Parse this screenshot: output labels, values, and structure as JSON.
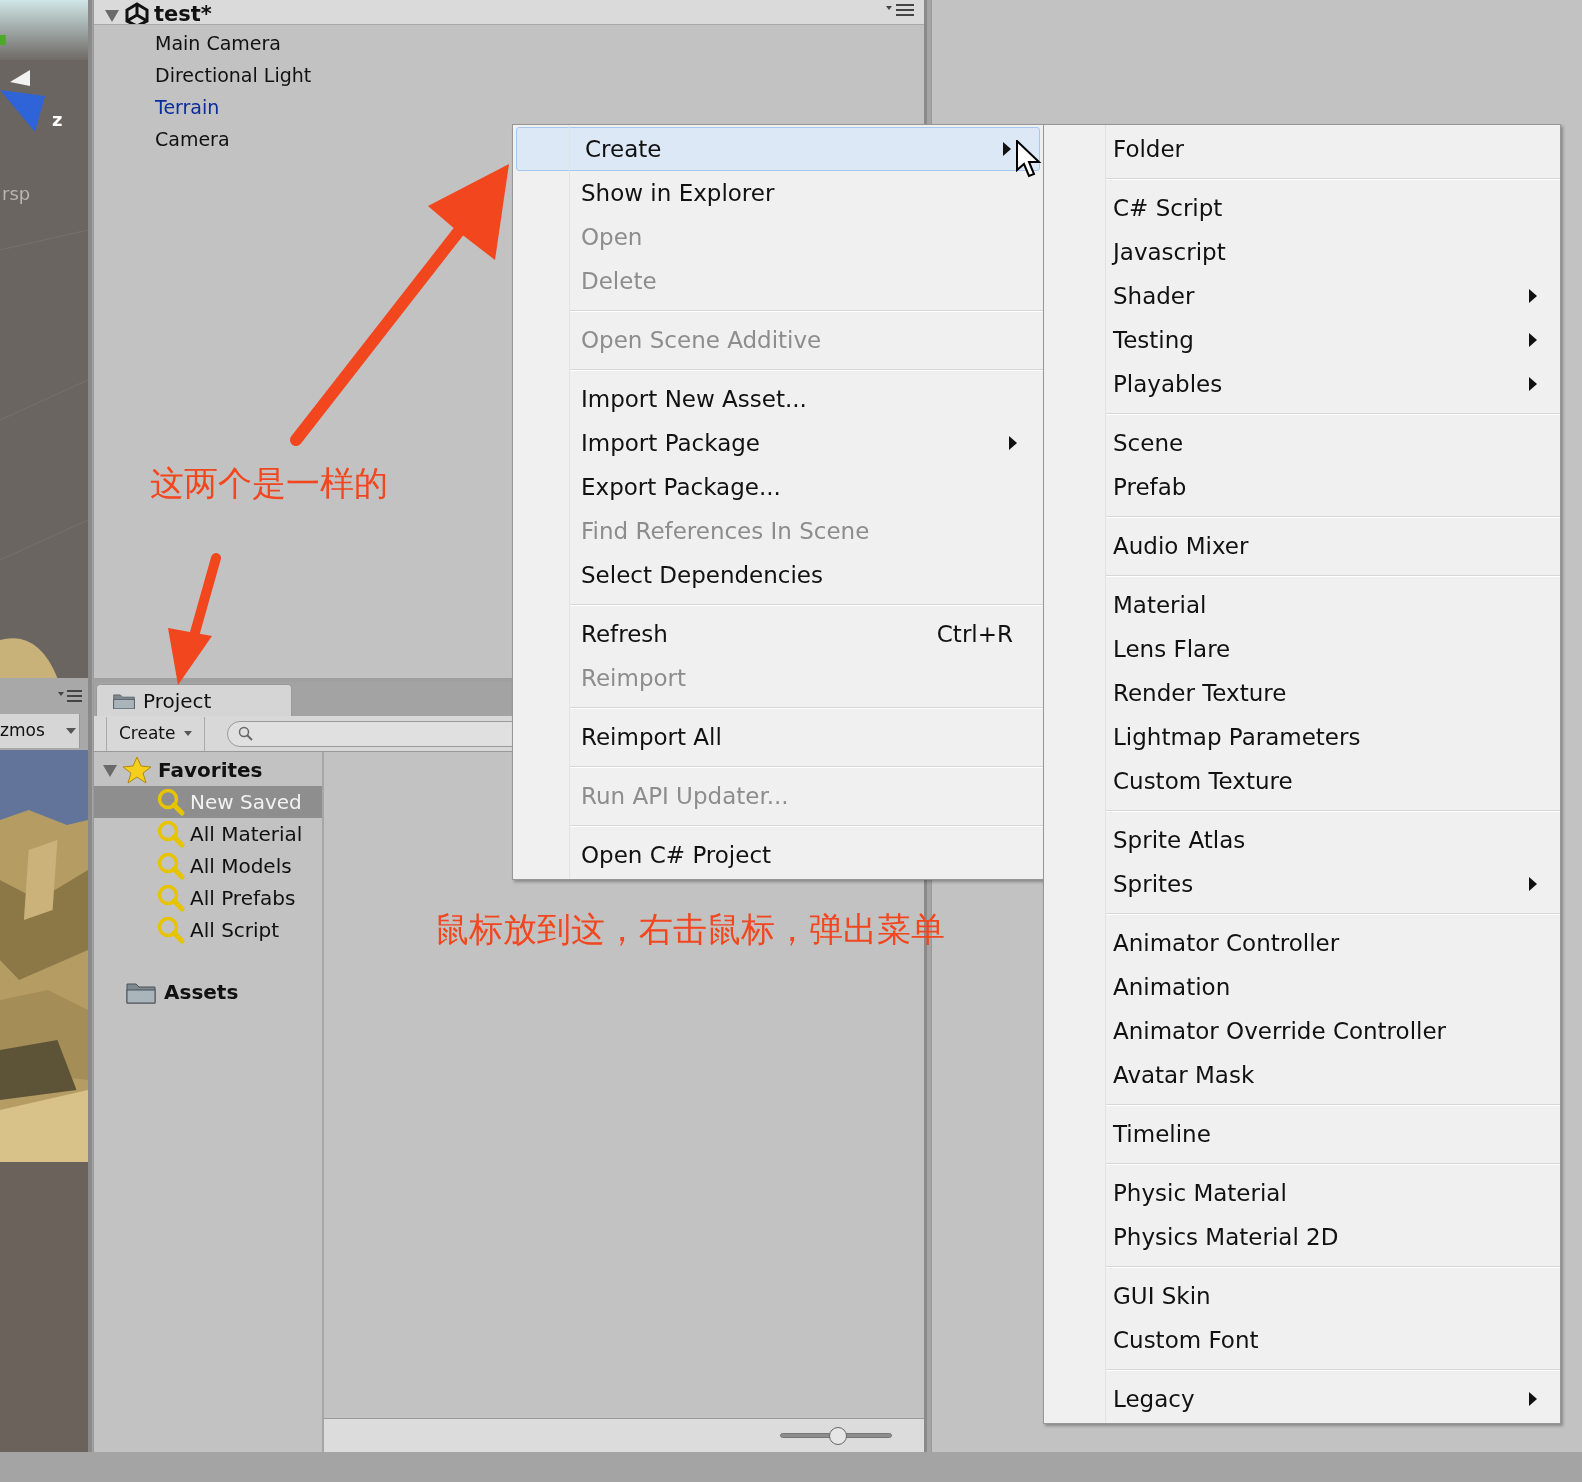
{
  "scene_view": {
    "label": "rsp",
    "axis": "z"
  },
  "scene_toolbar": {
    "gizmos": "zmos"
  },
  "hierarchy": {
    "scene": "test*",
    "expanded": true,
    "items": [
      {
        "label": "Main Camera",
        "prefab": false
      },
      {
        "label": "Directional Light",
        "prefab": false
      },
      {
        "label": "Terrain",
        "prefab": true
      },
      {
        "label": "Camera",
        "prefab": false
      }
    ]
  },
  "project": {
    "tab": "Project",
    "create_button": "Create",
    "tree": [
      {
        "label": "Favorites",
        "kind": "favorites",
        "expanded": true,
        "children": [
          {
            "label": "New Saved",
            "selected": true
          },
          {
            "label": "All Material",
            "selected": false
          },
          {
            "label": "All Models",
            "selected": false
          },
          {
            "label": "All Prefabs",
            "selected": false
          },
          {
            "label": "All Script",
            "selected": false
          }
        ]
      },
      {
        "label": "Assets",
        "kind": "folder"
      }
    ],
    "zoom_slider": {
      "level": 0.52
    }
  },
  "context_menu": {
    "groups": [
      {
        "items": [
          {
            "label": "Create",
            "disabled": false,
            "submenu": true,
            "selected": true
          },
          {
            "label": "Show in Explorer",
            "disabled": false,
            "submenu": false,
            "selected": false
          },
          {
            "label": "Open",
            "disabled": true,
            "submenu": false,
            "selected": false
          },
          {
            "label": "Delete",
            "disabled": true,
            "submenu": false,
            "selected": false
          }
        ]
      },
      {
        "items": [
          {
            "label": "Open Scene Additive",
            "disabled": true,
            "submenu": false,
            "selected": false
          }
        ]
      },
      {
        "items": [
          {
            "label": "Import New Asset...",
            "disabled": false,
            "submenu": false,
            "selected": false
          },
          {
            "label": "Import Package",
            "disabled": false,
            "submenu": true,
            "selected": false
          },
          {
            "label": "Export Package...",
            "disabled": false,
            "submenu": false,
            "selected": false
          },
          {
            "label": "Find References In Scene",
            "disabled": true,
            "submenu": false,
            "selected": false
          },
          {
            "label": "Select Dependencies",
            "disabled": false,
            "submenu": false,
            "selected": false
          }
        ]
      },
      {
        "items": [
          {
            "label": "Refresh",
            "shortcut": "Ctrl+R",
            "disabled": false,
            "submenu": false,
            "selected": false
          },
          {
            "label": "Reimport",
            "disabled": true,
            "submenu": false,
            "selected": false
          }
        ]
      },
      {
        "items": [
          {
            "label": "Reimport All",
            "disabled": false,
            "submenu": false,
            "selected": false
          }
        ]
      },
      {
        "items": [
          {
            "label": "Run API Updater...",
            "disabled": true,
            "submenu": false,
            "selected": false
          }
        ]
      },
      {
        "items": [
          {
            "label": "Open C# Project",
            "disabled": false,
            "submenu": false,
            "selected": false
          }
        ]
      }
    ]
  },
  "submenu": {
    "groups": [
      {
        "items": [
          {
            "label": "Folder",
            "submenu": false
          }
        ]
      },
      {
        "items": [
          {
            "label": "C# Script",
            "submenu": false
          },
          {
            "label": "Javascript",
            "submenu": false
          },
          {
            "label": "Shader",
            "submenu": true
          },
          {
            "label": "Testing",
            "submenu": true
          },
          {
            "label": "Playables",
            "submenu": true
          }
        ]
      },
      {
        "items": [
          {
            "label": "Scene",
            "submenu": false
          },
          {
            "label": "Prefab",
            "submenu": false
          }
        ]
      },
      {
        "items": [
          {
            "label": "Audio Mixer",
            "submenu": false
          }
        ]
      },
      {
        "items": [
          {
            "label": "Material",
            "submenu": false
          },
          {
            "label": "Lens Flare",
            "submenu": false
          },
          {
            "label": "Render Texture",
            "submenu": false
          },
          {
            "label": "Lightmap Parameters",
            "submenu": false
          },
          {
            "label": "Custom Texture",
            "submenu": false
          }
        ]
      },
      {
        "items": [
          {
            "label": "Sprite Atlas",
            "submenu": false
          },
          {
            "label": "Sprites",
            "submenu": true
          }
        ]
      },
      {
        "items": [
          {
            "label": "Animator Controller",
            "submenu": false
          },
          {
            "label": "Animation",
            "submenu": false
          },
          {
            "label": "Animator Override Controller",
            "submenu": false
          },
          {
            "label": "Avatar Mask",
            "submenu": false
          }
        ]
      },
      {
        "items": [
          {
            "label": "Timeline",
            "submenu": false
          }
        ]
      },
      {
        "items": [
          {
            "label": "Physic Material",
            "submenu": false
          },
          {
            "label": "Physics Material 2D",
            "submenu": false
          }
        ]
      },
      {
        "items": [
          {
            "label": "GUI Skin",
            "submenu": false
          },
          {
            "label": "Custom Font",
            "submenu": false
          }
        ]
      },
      {
        "items": [
          {
            "label": "Legacy",
            "submenu": true
          }
        ]
      }
    ]
  },
  "annotations": [
    {
      "text": "这两个是一样的"
    },
    {
      "text": "鼠标放到这，右击鼠标，弹出菜单"
    }
  ]
}
